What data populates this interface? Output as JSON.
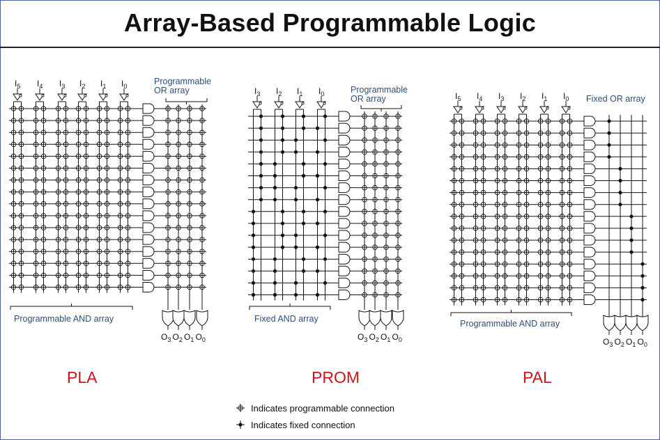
{
  "title": "Array-Based Programmable Logic",
  "pla": {
    "inputs": [
      "5",
      "4",
      "3",
      "2",
      "1",
      "0"
    ],
    "or_label_1": "Programmable",
    "or_label_2": "OR array",
    "and_label": "Programmable AND array",
    "outputs": [
      "3",
      "2",
      "1",
      "0"
    ],
    "name": "PLA"
  },
  "prom": {
    "inputs": [
      "3",
      "2",
      "1",
      "0"
    ],
    "or_label_1": "Programmable",
    "or_label_2": "OR array",
    "and_label": "Fixed AND array",
    "outputs": [
      "3",
      "2",
      "1",
      "0"
    ],
    "name": "PROM"
  },
  "pal": {
    "inputs": [
      "5",
      "4",
      "3",
      "2",
      "1",
      "0"
    ],
    "or_label": "Fixed OR array",
    "and_label": "Programmable AND array",
    "outputs": [
      "3",
      "2",
      "1",
      "0"
    ],
    "name": "PAL"
  },
  "legend": {
    "programmable": "Indicates programmable connection",
    "fixed": "Indicates fixed connection"
  },
  "colors": {
    "title": "#111111",
    "labels": "#2d4f7a",
    "architecture": "#c8161c",
    "lines": "#111111"
  }
}
